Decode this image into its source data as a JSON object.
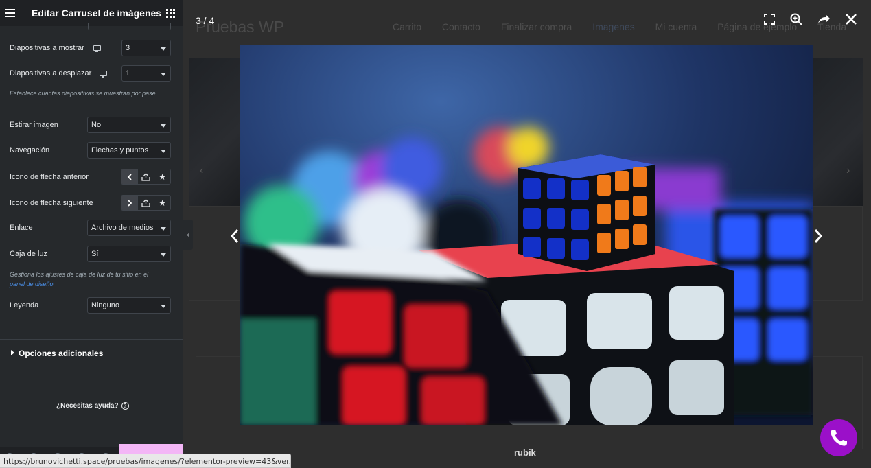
{
  "sidebar": {
    "title": "Editar Carrusel de imágenes",
    "controls": {
      "slides_to_show": {
        "label": "Diapositivas a mostrar",
        "value": "3"
      },
      "slides_to_scroll": {
        "label": "Diapositivas a desplazar",
        "value": "1"
      },
      "slides_hint": "Establece cuantas diapositivas se muestran por pase.",
      "stretch": {
        "label": "Estirar imagen",
        "value": "No"
      },
      "navigation": {
        "label": "Navegación",
        "value": "Flechas y puntos"
      },
      "prev_arrow": {
        "label": "Icono de flecha anterior"
      },
      "next_arrow": {
        "label": "Icono de flecha siguiente"
      },
      "link": {
        "label": "Enlace",
        "value": "Archivo de medios"
      },
      "lightbox": {
        "label": "Caja de luz",
        "value": "Sí"
      },
      "lightbox_hint_prefix": "Gestiona los ajustes de caja de luz de tu sitio en el",
      "lightbox_hint_link": "panel de diseño",
      "lightbox_hint_suffix": ".",
      "caption": {
        "label": "Leyenda",
        "value": "Ninguno"
      }
    },
    "additional_options": "Opciones adicionales",
    "help": "¿Necesitas ayuda?"
  },
  "page": {
    "site_title": "Pruebas WP",
    "nav": [
      "Carrito",
      "Contacto",
      "Finalizar compra",
      "Imagenes",
      "Mi cuenta",
      "Página de ejemplo",
      "Tienda"
    ],
    "current_nav": "Imagenes",
    "image_caption": "rubik"
  },
  "lightbox": {
    "counter": "3 / 4",
    "tools": [
      "fullscreen-icon",
      "zoom-in-icon",
      "share-icon",
      "close-icon"
    ]
  },
  "statusbar": {
    "url": "https://brunovichetti.space/pruebas/imagenes/?elementor-preview=43&ver..."
  },
  "colors": {
    "sidebar_bg": "#26292c",
    "header_bg": "#1f2124",
    "link": "#4b8fe8",
    "call_button": "#9b10c9"
  }
}
